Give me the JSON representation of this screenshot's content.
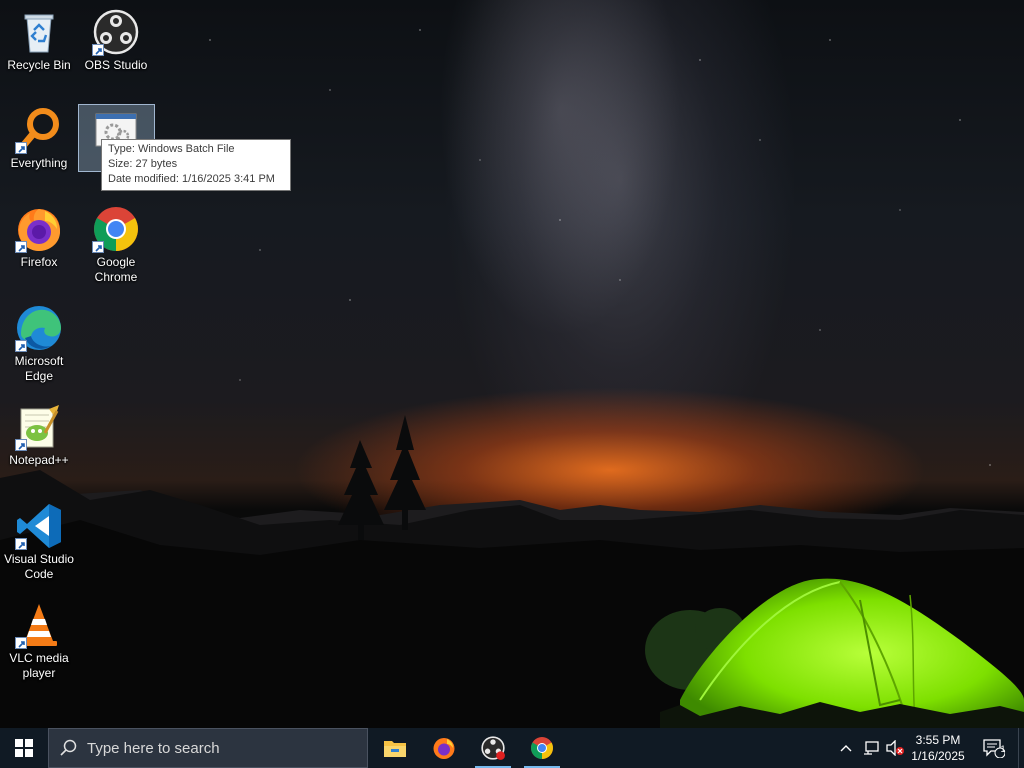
{
  "desktop_icons": [
    {
      "label": "Recycle Bin",
      "icon": "recycle-bin-icon"
    },
    {
      "label": "OBS Studio",
      "icon": "obs-studio-icon"
    },
    {
      "label": "Everything",
      "icon": "everything-search-icon"
    },
    {
      "label": "Firefox",
      "icon": "firefox-icon"
    },
    {
      "label": "Google Chrome",
      "icon": "chrome-icon"
    },
    {
      "label": "Microsoft Edge",
      "icon": "edge-icon"
    },
    {
      "label": "Notepad++",
      "icon": "notepad-plus-plus-icon"
    },
    {
      "label": "Visual Studio Code",
      "icon": "vscode-icon"
    },
    {
      "label": "VLC media player",
      "icon": "vlc-icon"
    }
  ],
  "selected_file": {
    "icon": "batch-file-icon"
  },
  "tooltip": {
    "type": "Type: Windows Batch File",
    "size": "Size: 27 bytes",
    "modified": "Date modified: 1/16/2025 3:41 PM"
  },
  "taskbar": {
    "search_placeholder": "Type here to search",
    "pinned": [
      {
        "name": "File Explorer",
        "icon": "file-explorer-icon"
      },
      {
        "name": "Firefox",
        "icon": "firefox-icon"
      },
      {
        "name": "OBS Studio",
        "icon": "obs-studio-icon",
        "recording": true
      },
      {
        "name": "Google Chrome",
        "icon": "chrome-icon"
      }
    ],
    "clock": {
      "time": "3:55 PM",
      "date": "1/16/2025"
    },
    "notification_count": "1"
  },
  "colors": {
    "taskbar_bg": "#101a24",
    "accent": "#76b9ed",
    "tent_green": "#7ee000"
  }
}
